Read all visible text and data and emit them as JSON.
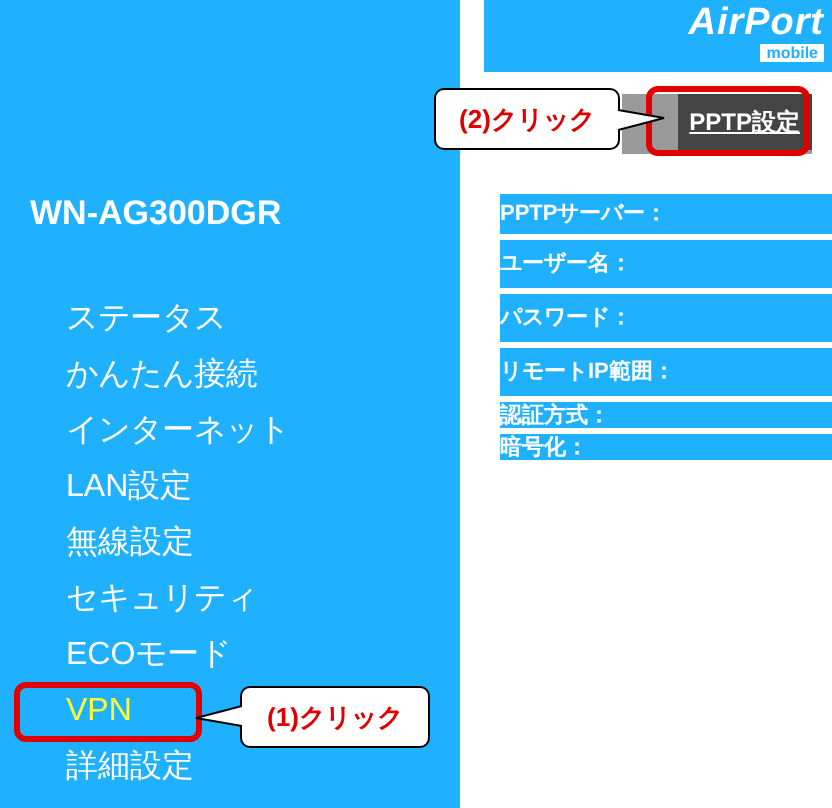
{
  "sidebar": {
    "title": "WN-AG300DGR",
    "items": [
      {
        "label": "ステータス",
        "selected": false
      },
      {
        "label": "かんたん接続",
        "selected": false
      },
      {
        "label": "インターネット",
        "selected": false
      },
      {
        "label": "LAN設定",
        "selected": false
      },
      {
        "label": "無線設定",
        "selected": false
      },
      {
        "label": "セキュリティ",
        "selected": false
      },
      {
        "label": "ECOモード",
        "selected": false
      },
      {
        "label": "VPN",
        "selected": true
      },
      {
        "label": "詳細設定",
        "selected": false
      }
    ]
  },
  "logo": {
    "name": "AirPort",
    "sub": "mobile"
  },
  "tab": {
    "label": "PPTP設定",
    "selected": true
  },
  "fields": [
    {
      "label": "PPTPサーバー："
    },
    {
      "label": "ユーザー名："
    },
    {
      "label": "パスワード："
    },
    {
      "label": "リモートIP範囲："
    },
    {
      "label": "認証方式："
    },
    {
      "label": "暗号化："
    }
  ],
  "callouts": [
    {
      "text": "(1)クリック"
    },
    {
      "text": "(2)クリック"
    }
  ]
}
